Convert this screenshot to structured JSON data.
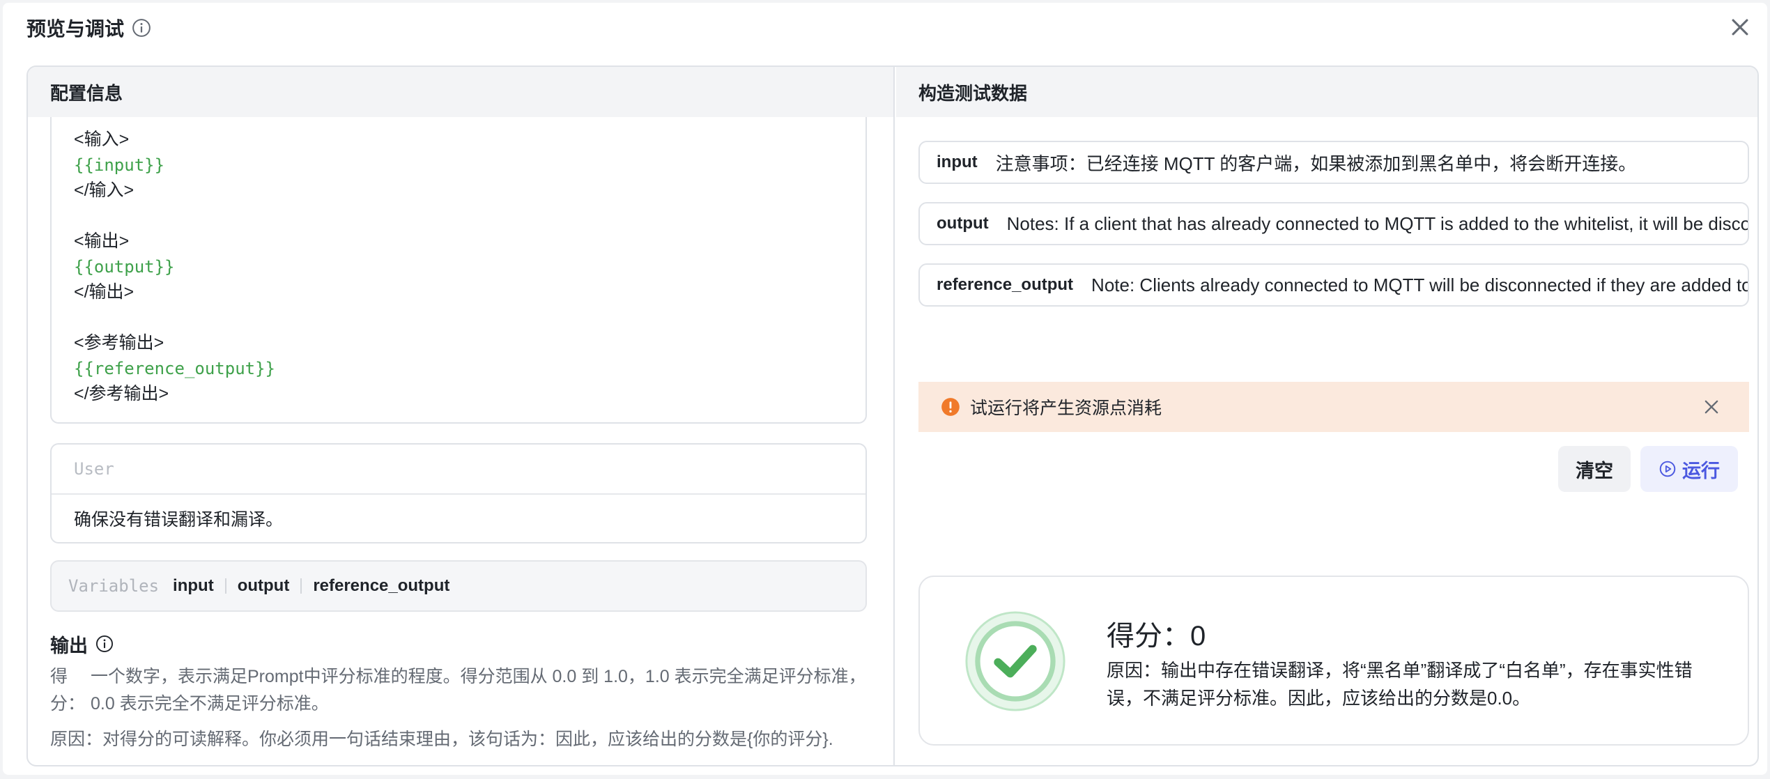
{
  "dialog": {
    "title": "预览与调试"
  },
  "left": {
    "header": "配置信息",
    "code_lines": [
      {
        "text": "<输入>",
        "type": "tag"
      },
      {
        "text": "{{input}}",
        "type": "var"
      },
      {
        "text": "</输入>",
        "type": "tag"
      },
      {
        "text": "",
        "type": "blank"
      },
      {
        "text": "<输出>",
        "type": "tag"
      },
      {
        "text": "{{output}}",
        "type": "var"
      },
      {
        "text": "</输出>",
        "type": "tag"
      },
      {
        "text": "",
        "type": "blank"
      },
      {
        "text": "<参考输出>",
        "type": "tag"
      },
      {
        "text": "{{reference_output}}",
        "type": "var"
      },
      {
        "text": "</参考输出>",
        "type": "tag"
      }
    ],
    "user": {
      "role": "User",
      "text": "确保没有错误翻译和漏译。"
    },
    "variables": {
      "label": "Variables",
      "items": [
        "input",
        "output",
        "reference_output"
      ]
    },
    "output": {
      "title": "输出",
      "rows": [
        {
          "key": "得分：",
          "value": "一个数字，表示满足Prompt中评分标准的程度。得分范围从 0.0 到 1.0，1.0 表示完全满足评分标准，0.0 表示完全不满足评分标准。"
        },
        {
          "key": "原因：",
          "value": "对得分的可读解释。你必须用一句话结束理由，该句话为：因此，应该给出的分数是{你的评分}."
        }
      ]
    }
  },
  "right": {
    "header": "构造测试数据",
    "fields": [
      {
        "key": "input",
        "value": "注意事项：已经连接 MQTT 的客户端，如果被添加到黑名单中，将会断开连接。"
      },
      {
        "key": "output",
        "value": "Notes: If a client that has already connected to MQTT is added to the whitelist, it will be disconnected."
      },
      {
        "key": "reference_output",
        "value": "Note: Clients already connected to MQTT will be disconnected if they are added to the blacklist."
      }
    ],
    "warning": "试运行将产生资源点消耗",
    "buttons": {
      "clear": "清空",
      "run": "运行"
    },
    "result": {
      "score_label": "得分：",
      "score_value": "0",
      "reason": "原因：输出中存在错误翻译，将“黑名单”翻译成了“白名单”，存在事实性错误，不满足评分标准。因此，应该给出的分数是0.0。"
    }
  },
  "colors": {
    "accent": "#4b58e0",
    "success": "#4cae5a",
    "warning": "#f07a2a",
    "variable": "#3ea14a"
  }
}
